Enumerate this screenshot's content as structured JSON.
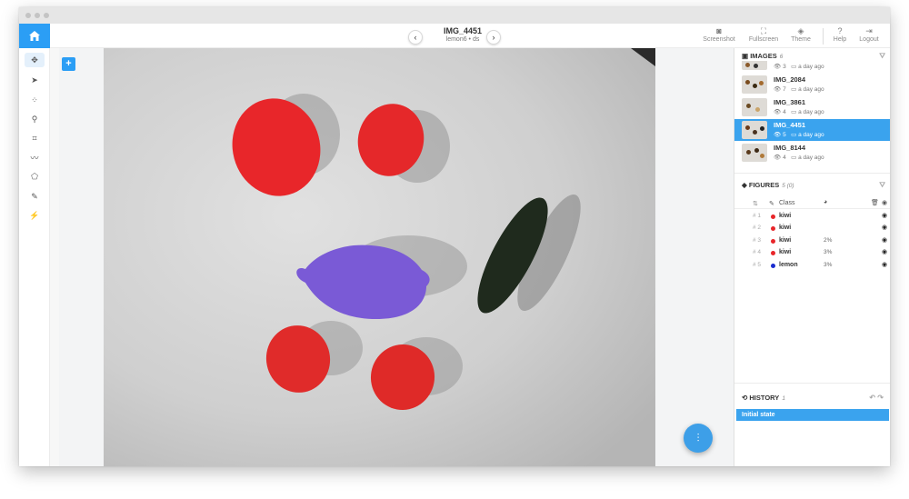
{
  "window": {
    "chrome": "window-titlebar"
  },
  "header": {
    "image_title": "IMG_4451",
    "image_subtitle": "lemon6 • ds",
    "prev_label": "‹",
    "next_label": "›",
    "toolbar": [
      {
        "label": "Screenshot",
        "icon": "camera-icon"
      },
      {
        "label": "Fullscreen",
        "icon": "fullscreen-icon"
      },
      {
        "label": "Theme",
        "icon": "theme-icon"
      },
      {
        "label": "Help",
        "icon": "help-icon"
      },
      {
        "label": "Logout",
        "icon": "logout-icon"
      }
    ]
  },
  "tools": [
    "move-icon",
    "pointer-icon",
    "points-icon",
    "keypoint-icon",
    "bbox-icon",
    "polyline-icon",
    "polygon-icon",
    "brush-icon",
    "magic-wand-icon"
  ],
  "images_panel": {
    "title": "IMAGES",
    "count": "6",
    "items": [
      {
        "name": "",
        "views": "3",
        "time": "a day ago",
        "selected": false
      },
      {
        "name": "IMG_2084",
        "views": "7",
        "time": "a day ago",
        "selected": false
      },
      {
        "name": "IMG_3861",
        "views": "4",
        "time": "a day ago",
        "selected": false
      },
      {
        "name": "IMG_4451",
        "views": "5",
        "time": "a day ago",
        "selected": true
      },
      {
        "name": "IMG_8144",
        "views": "4",
        "time": "a day ago",
        "selected": false
      }
    ]
  },
  "figures_panel": {
    "title": "FIGURES",
    "count": "5 (0)",
    "column_class": "Class",
    "rows": [
      {
        "num": "1",
        "class": "kiwi",
        "color": "#e8262a",
        "pct": ""
      },
      {
        "num": "2",
        "class": "kiwi",
        "color": "#e8262a",
        "pct": ""
      },
      {
        "num": "3",
        "class": "kiwi",
        "color": "#e8262a",
        "pct": "2%"
      },
      {
        "num": "4",
        "class": "kiwi",
        "color": "#e8262a",
        "pct": "3%"
      },
      {
        "num": "5",
        "class": "lemon",
        "color": "#1a2ccf",
        "pct": "3%"
      }
    ]
  },
  "history_panel": {
    "title": "HISTORY",
    "count": "1",
    "items": [
      "Initial state"
    ]
  },
  "colors": {
    "accent": "#2b9ef5",
    "kiwi": "#e8262a",
    "lemon": "#7a5ad6",
    "cucumber": "#1f2a1d"
  }
}
